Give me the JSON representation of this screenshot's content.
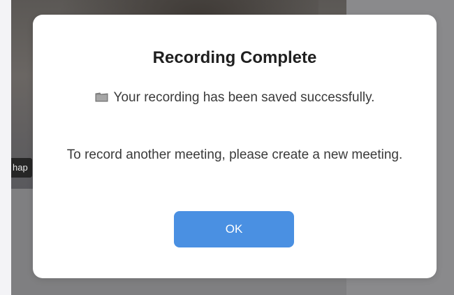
{
  "background": {
    "participant_name_fragment": "hap"
  },
  "dialog": {
    "title": "Recording Complete",
    "saved_message": "Your recording has been saved successfully.",
    "saved_icon": "folder-icon",
    "info_message": "To record another meeting, please create a new meeting.",
    "ok_label": "OK"
  },
  "colors": {
    "accent": "#4a90e2",
    "overlay": "#7d7d7f",
    "dialog_background": "#ffffff"
  }
}
